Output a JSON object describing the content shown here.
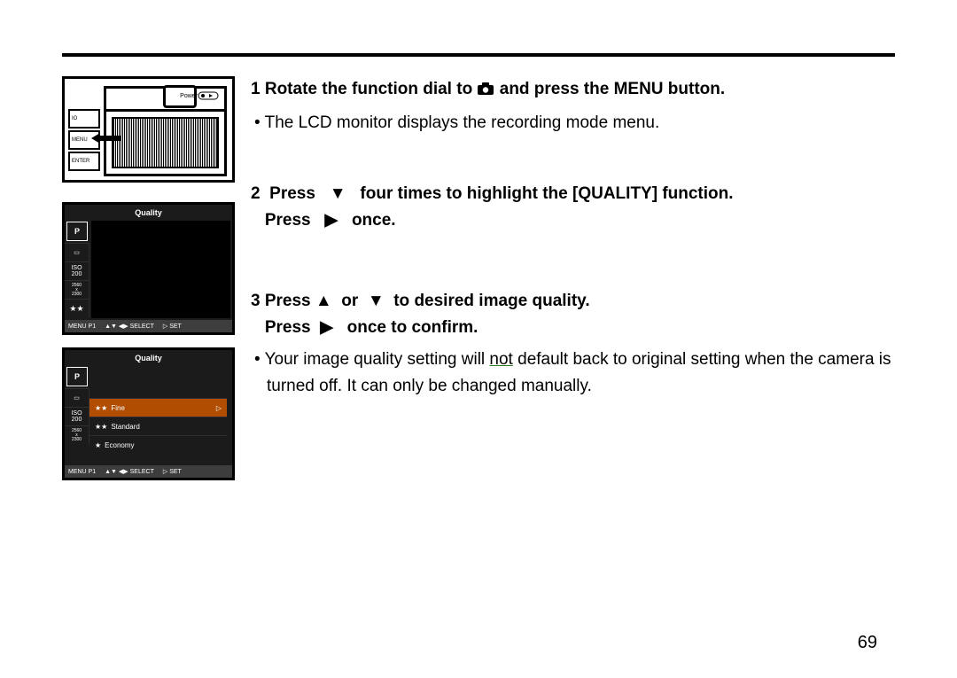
{
  "page_number": "69",
  "illus1": {
    "power_label": "Power",
    "btn_labels": [
      "IO",
      "MENU",
      "ENTER"
    ]
  },
  "lcd_a": {
    "title": "Quality",
    "icons": {
      "p": "P",
      "iso": "ISO\n200",
      "size": "2560\nx\n2300",
      "stars": "★★"
    },
    "footer": {
      "menu": "MENU P1",
      "nav": "▲▼  ◀▶  SELECT",
      "set": "▷ SET"
    }
  },
  "lcd_b": {
    "title": "Quality",
    "icons": {
      "p": "P",
      "iso": "ISO\n200",
      "size": "2560\nx\n2300"
    },
    "options": [
      {
        "stars": "★★",
        "label": "Fine",
        "selected": true
      },
      {
        "stars": "★★",
        "label": "Standard",
        "selected": false
      },
      {
        "stars": "★",
        "label": "Economy",
        "selected": false
      }
    ],
    "footer": {
      "menu": "MENU P1",
      "nav": "▲▼  ◀▶  SELECT",
      "set": "▷ SET"
    }
  },
  "steps": {
    "s1": {
      "num": "1",
      "text_a": "Rotate the function dial to",
      "text_b": "and press the MENU button.",
      "bullet": "The LCD monitor displays the recording mode menu."
    },
    "s2": {
      "num": "2",
      "line1_a": "Press",
      "line1_b": "four times to highlight the [QUALITY] function.",
      "line2_a": "Press",
      "line2_b": "once."
    },
    "s3": {
      "num": "3",
      "line1_a": "Press",
      "line1_or": "or",
      "line1_b": "to desired image quality.",
      "line2_a": "Press",
      "line2_b": "once to confirm.",
      "bullet_a": "Your image quality setting will ",
      "bullet_not": "not",
      "bullet_b": " default back to original setting when the camera is turned off. It can only be changed manually."
    }
  }
}
